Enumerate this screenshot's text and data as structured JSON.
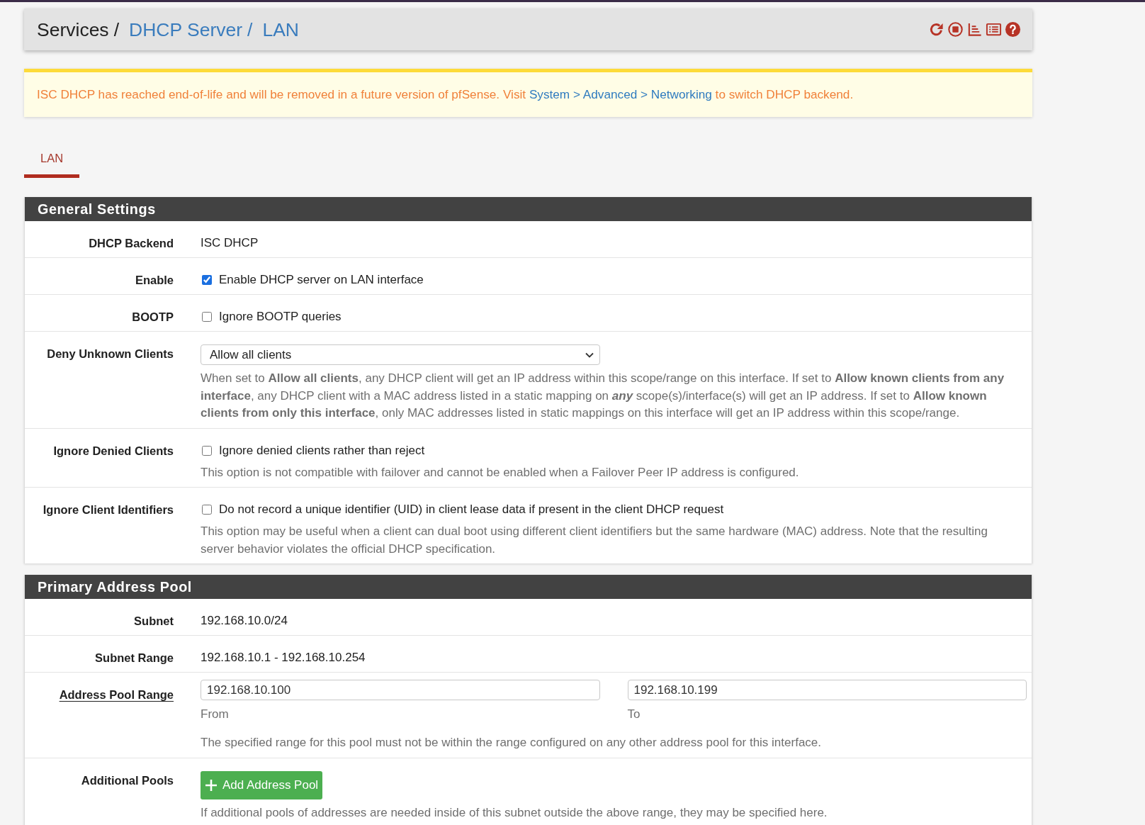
{
  "breadcrumb": [
    {
      "text": "Services",
      "kind": "plain",
      "separator": "/"
    },
    {
      "text": "DHCP Server",
      "kind": "link",
      "separator": "/"
    },
    {
      "text": "LAN",
      "kind": "link"
    }
  ],
  "alert": {
    "text_before": "ISC DHCP has reached end-of-life and will be removed in a future version of pfSense. Visit",
    "link": "System > Advanced > Networking",
    "text_after": "to switch DHCP backend."
  },
  "tabs": [
    {
      "label": "LAN",
      "selected": true
    }
  ],
  "sections": [
    {
      "title": "General Settings",
      "rows": [
        {
          "kind": "static",
          "label": "DHCP Backend",
          "required": false,
          "value": "ISC DHCP"
        },
        {
          "kind": "checkbox",
          "label": "Enable",
          "required": false,
          "checkbox_label": "Enable DHCP server on LAN interface",
          "checked": true
        },
        {
          "kind": "checkbox",
          "label": "BOOTP",
          "required": false,
          "checkbox_label": "Ignore BOOTP queries",
          "checked": false
        },
        {
          "kind": "select",
          "label": "Deny Unknown Clients",
          "required": false,
          "value": "Allow all clients",
          "help": "When set to **Allow all clients**, any DHCP client will get an IP address within this scope/range on this interface. If set to **Allow known clients from any interface**, any DHCP client with a MAC address listed in a static mapping on *any* scope(s)/interface(s) will get an IP address. If set to **Allow known clients from only this interface**, only MAC addresses listed in static mappings on this interface will get an IP address within this scope/range."
        },
        {
          "kind": "checkbox",
          "label": "Ignore Denied Clients",
          "required": false,
          "checkbox_label": "Ignore denied clients rather than reject",
          "checked": false,
          "help": "This option is not compatible with failover and cannot be enabled when a Failover Peer IP address is configured."
        },
        {
          "kind": "checkbox",
          "label": "Ignore Client Identifiers",
          "required": false,
          "checkbox_label": "Do not record a unique identifier (UID) in client lease data if present in the client DHCP request",
          "checked": false,
          "help": "This option may be useful when a client can dual boot using different client identifiers but the same hardware (MAC) address. Note that the resulting server behavior violates the official DHCP specification."
        }
      ]
    },
    {
      "title": "Primary Address Pool",
      "rows": [
        {
          "kind": "static",
          "label": "Subnet",
          "required": false,
          "value": "192.168.10.0/24"
        },
        {
          "kind": "static",
          "label": "Subnet Range",
          "required": false,
          "value": "192.168.10.1 - 192.168.10.254"
        },
        {
          "kind": "range",
          "label": "Address Pool Range",
          "required": true,
          "fields": [
            {
              "value": "192.168.10.100",
              "caption": "From"
            },
            {
              "value": "192.168.10.199",
              "caption": "To"
            }
          ],
          "help": "The specified range for this pool must not be within the range configured on any other address pool for this interface."
        },
        {
          "kind": "button",
          "label": "Additional Pools",
          "required": false,
          "button": "Add Address Pool",
          "help": "If additional pools of addresses are needed inside of this subnet outside the above range, they may be specified here."
        }
      ]
    }
  ]
}
